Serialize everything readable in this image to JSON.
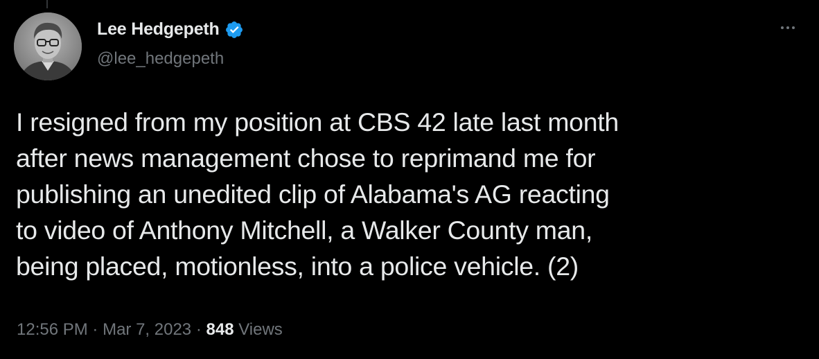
{
  "tweet": {
    "author": {
      "display_name": "Lee Hedgepeth",
      "handle": "@lee_hedgepeth",
      "verified": true,
      "avatar_icon": "profile-photo"
    },
    "more_icon": "more-horizontal-icon",
    "text_lines": [
      "I resigned from my position at CBS 42 late last month",
      "after news management chose to reprimand me for",
      "publishing an unedited clip of Alabama's AG reacting",
      "to video of Anthony Mitchell, a Walker County man,",
      "being placed, motionless, into a police vehicle. (2)"
    ],
    "time": "12:56 PM",
    "separator": "·",
    "date": "Mar 7, 2023",
    "views_count": "848",
    "views_label": "Views"
  },
  "colors": {
    "background": "#000000",
    "primary_text": "#e7e9ea",
    "secondary_text": "#71767b",
    "verified_blue": "#1d9bf0"
  }
}
